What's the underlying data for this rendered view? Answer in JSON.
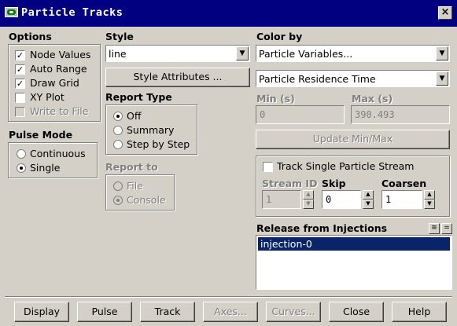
{
  "window": {
    "title": "Particle Tracks",
    "close_glyph": "×"
  },
  "options": {
    "heading": "Options",
    "items": [
      {
        "label": "Node Values",
        "checked": true,
        "enabled": true
      },
      {
        "label": "Auto Range",
        "checked": true,
        "enabled": true
      },
      {
        "label": "Draw Grid",
        "checked": true,
        "enabled": true
      },
      {
        "label": "XY Plot",
        "checked": false,
        "enabled": true
      },
      {
        "label": "Write to File",
        "checked": false,
        "enabled": false
      }
    ]
  },
  "pulse_mode": {
    "heading": "Pulse Mode",
    "options": [
      {
        "label": "Continuous",
        "selected": false
      },
      {
        "label": "Single",
        "selected": true
      }
    ]
  },
  "style": {
    "heading": "Style",
    "value": "line",
    "attributes_button": "Style Attributes ..."
  },
  "report_type": {
    "heading": "Report Type",
    "options": [
      {
        "label": "Off",
        "selected": true
      },
      {
        "label": "Summary",
        "selected": false
      },
      {
        "label": "Step by Step",
        "selected": false
      }
    ]
  },
  "report_to": {
    "heading": "Report to",
    "options": [
      {
        "label": "File",
        "selected": false
      },
      {
        "label": "Console",
        "selected": true
      }
    ]
  },
  "color_by": {
    "heading": "Color by",
    "category": "Particle Variables...",
    "variable": "Particle Residence Time",
    "min_label": "Min (s)",
    "min_value": "0",
    "max_label": "Max (s)",
    "max_value": "390.493",
    "update_button": "Update Min/Max"
  },
  "stream": {
    "track_label": "Track Single Particle Stream",
    "track_checked": false,
    "stream_id_label": "Stream ID",
    "stream_id_value": "1",
    "skip_label": "Skip",
    "skip_value": "0",
    "coarsen_label": "Coarsen",
    "coarsen_value": "1"
  },
  "release": {
    "heading": "Release from Injections",
    "items": [
      "injection-0"
    ],
    "selected_index": 0
  },
  "buttons": {
    "display": "Display",
    "pulse": "Pulse",
    "track": "Track",
    "axes": "Axes...",
    "curves": "Curves...",
    "close": "Close",
    "help": "Help"
  },
  "glyphs": {
    "check": "✓",
    "arrow_down": "▼",
    "arrow_up": "▲",
    "select_all": "≡",
    "deselect_all": "="
  }
}
